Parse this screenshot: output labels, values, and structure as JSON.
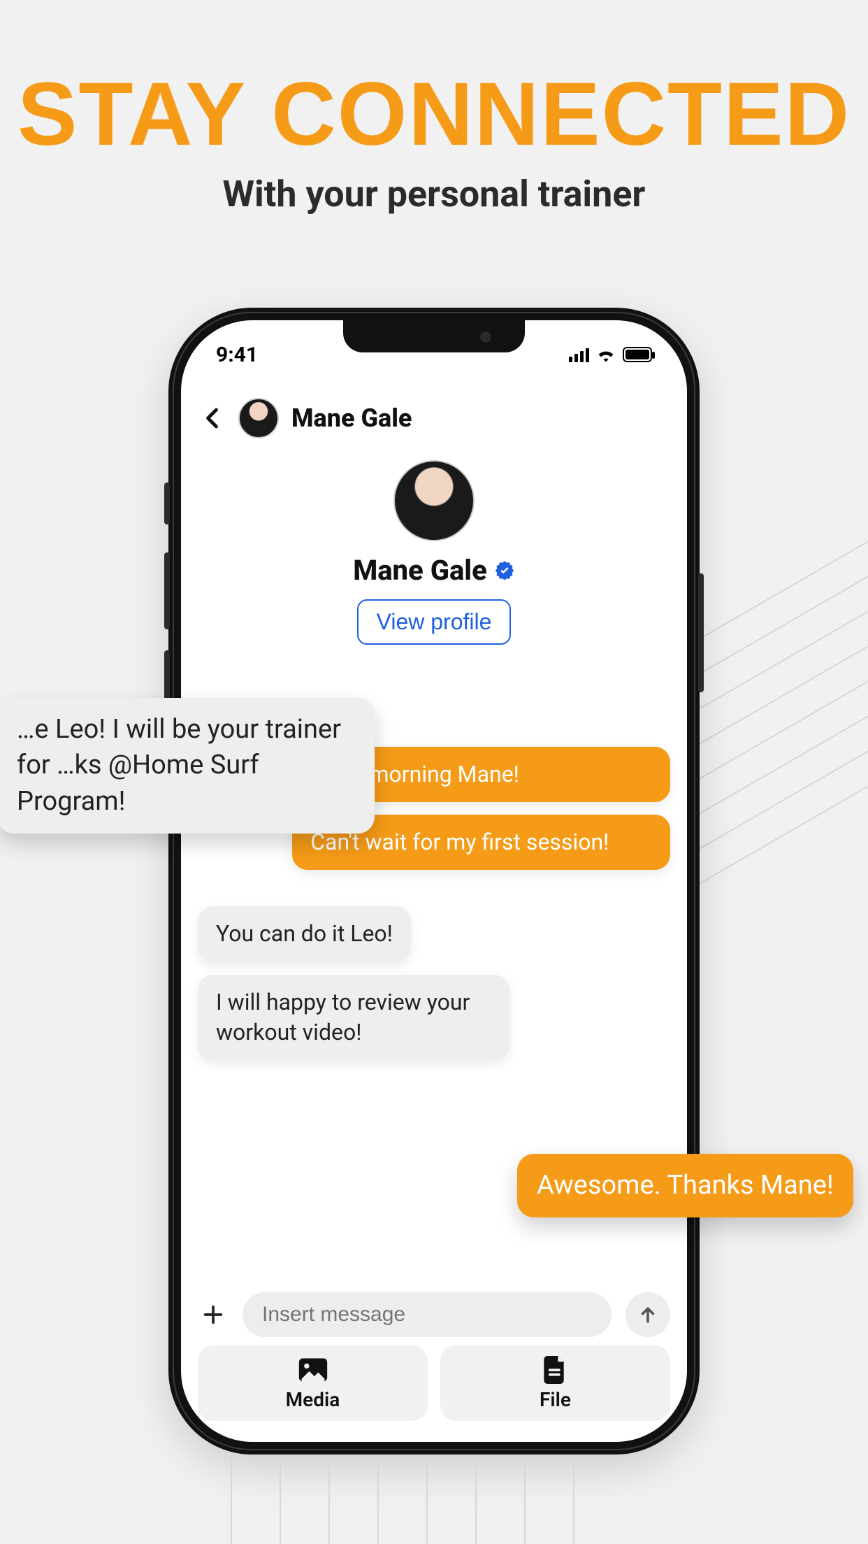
{
  "hero": {
    "title": "STAY CONNECTED",
    "subtitle": "With your personal trainer"
  },
  "status": {
    "time": "9:41"
  },
  "chat": {
    "contact_name": "Mane Gale",
    "profile_name": "Mane Gale",
    "view_profile_label": "View profile"
  },
  "messages": {
    "float_in_1": "…e Leo! I will be your trainer for …ks @Home Surf Program!",
    "out_1": "Good morning Mane!",
    "out_2": "Can't wait for my first session!",
    "in_1": "You can do it Leo!",
    "in_2": "I will happy to review your workout video!",
    "float_out_1": "Awesome. Thanks Mane!"
  },
  "composer": {
    "placeholder": "Insert message"
  },
  "attach": {
    "media_label": "Media",
    "file_label": "File"
  },
  "colors": {
    "accent": "#f59b17",
    "link": "#1f5fe0"
  }
}
